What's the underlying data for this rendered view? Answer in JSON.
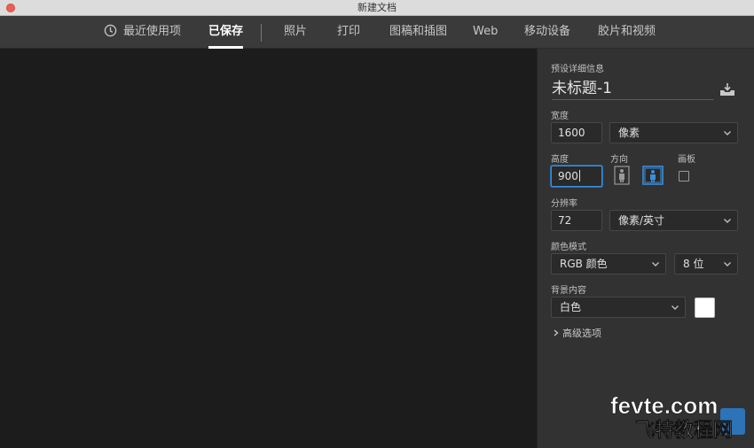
{
  "window": {
    "title": "新建文档"
  },
  "tabs": [
    {
      "label": "最近使用项"
    },
    {
      "label": "已保存"
    },
    {
      "label": "照片"
    },
    {
      "label": "打印"
    },
    {
      "label": "图稿和插图"
    },
    {
      "label": "Web"
    },
    {
      "label": "移动设备"
    },
    {
      "label": "胶片和视频"
    }
  ],
  "panel": {
    "section_title": "预设详细信息",
    "document_name": "未标题-1",
    "width": {
      "label": "宽度",
      "value": "1600",
      "unit": "像素"
    },
    "height": {
      "label": "高度",
      "value": "900"
    },
    "orientation": {
      "label": "方向",
      "selected": "landscape"
    },
    "artboard": {
      "label": "画板",
      "checked": false
    },
    "resolution": {
      "label": "分辨率",
      "value": "72",
      "unit": "像素/英寸"
    },
    "color_mode": {
      "label": "颜色模式",
      "mode": "RGB 颜色",
      "depth": "8 位"
    },
    "background": {
      "label": "背景内容",
      "value": "白色",
      "swatch_color": "#ffffff"
    },
    "advanced_label": "高级选项"
  },
  "watermark": {
    "text_line1": "fevte.com",
    "text_line2": "飞特教程网"
  },
  "colors": {
    "accent": "#3b8ddd",
    "panel_bg": "#323232",
    "canvas_bg": "#1c1c1c"
  }
}
